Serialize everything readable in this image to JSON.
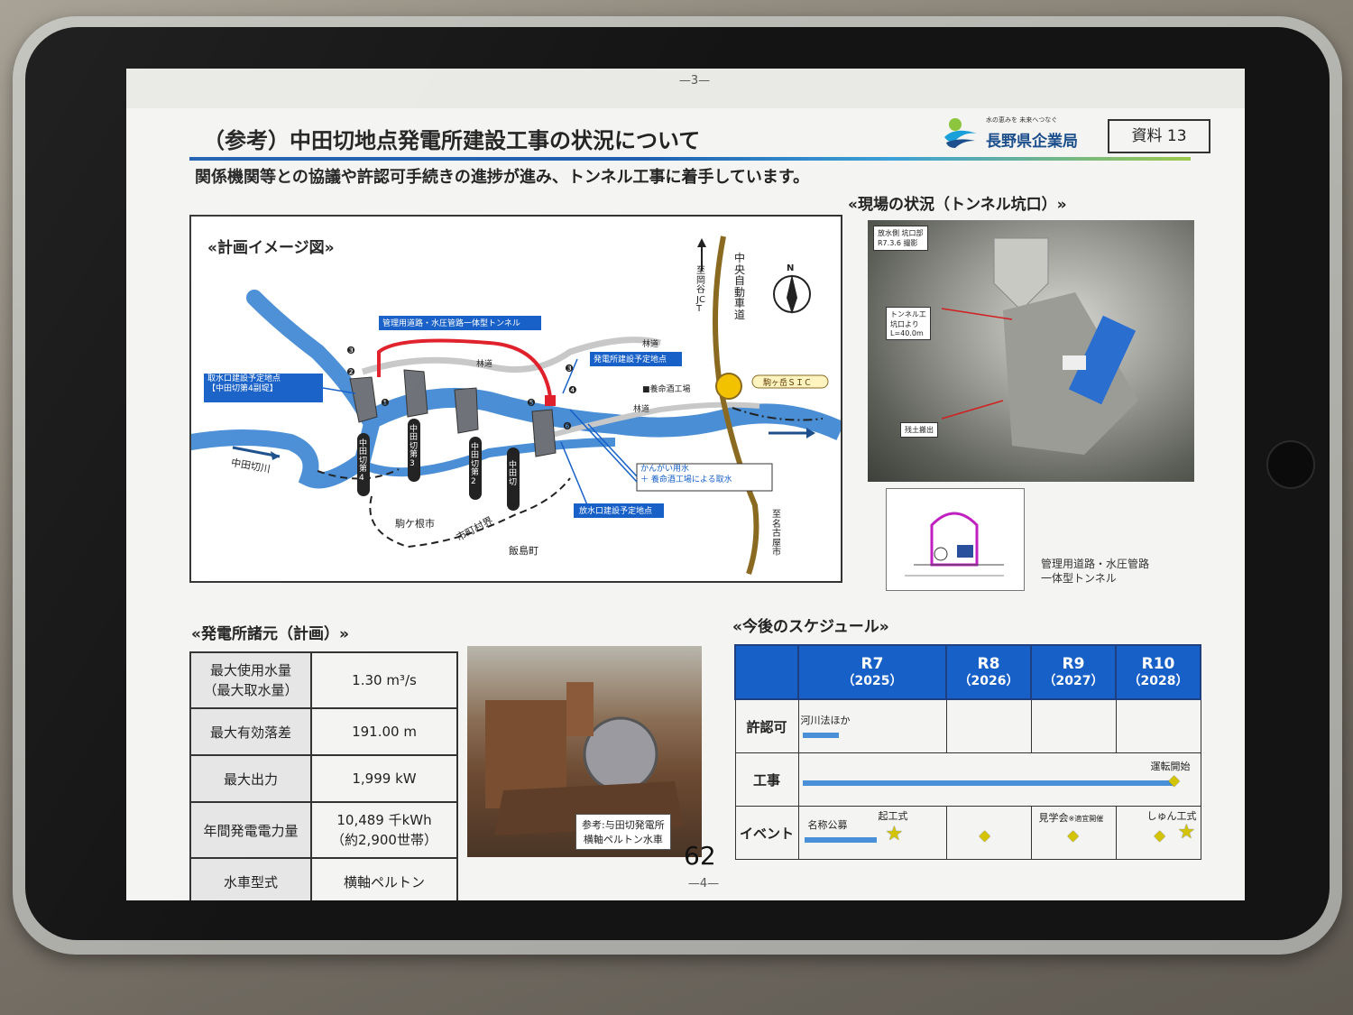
{
  "page": {
    "page_top": "—3—",
    "page_bottom": "—4—",
    "title": "（参考）中田切地点発電所建設工事の状況について",
    "subtitle": "関係機関等との協議や許認可手続きの進捗が進み、トンネル工事に着手しています。",
    "logo_tagline": "水の恵みを 未来へつなぐ",
    "logo_name": "長野県企業局",
    "doc_label": "資料 13",
    "handwritten": "62"
  },
  "plan": {
    "heading": "«計画イメージ図»",
    "labels": {
      "tunnel": "管理用道路・水圧管路一体型トンネル",
      "intake": "取水口建設予定地点\n【中田切第4副堤】",
      "powerhouse": "発電所建設予定地点",
      "outlet": "放水口建設予定地点",
      "irrigation": "かんがい用水\n＋ 養命酒工場による取水",
      "factory": "■養命酒工場",
      "road1": "林道",
      "road2": "林道",
      "road3": "林道",
      "expressway": "中央自動車道",
      "to_okaya": "至岡谷JCT",
      "to_nagoya": "至名古屋市",
      "ic": "駒ヶ岳ＳＩＣ",
      "river": "中田切川",
      "city1": "駒ケ根市",
      "city2": "飯島町",
      "boundary": "市町村界",
      "weir4": "中田切第4",
      "weir3": "中田切第3",
      "weir2": "中田切第2",
      "weir1": "中田切",
      "north": "N",
      "m1": "❶",
      "m2": "❷",
      "m3": "❸",
      "m5": "❺",
      "m6": "❻",
      "m3b": "❸",
      "m4": "❹"
    }
  },
  "site": {
    "heading": "«現場の状況（トンネル坑口）»",
    "photo_tag": "放水側 坑口部\nR7.3.6 撮影",
    "tunnel_tag": "トンネル工\n坑口より\nL=40.0m",
    "soil_tag": "残土搬出",
    "cross_caption": "管理用道路・水圧管路\n一体型トンネル"
  },
  "specs": {
    "heading": "«発電所諸元（計画）»",
    "rows": [
      {
        "k": "最大使用水量\n（最大取水量）",
        "v": "1.30 m³/s"
      },
      {
        "k": "最大有効落差",
        "v": "191.00 m"
      },
      {
        "k": "最大出力",
        "v": "1,999 kW"
      },
      {
        "k": "年間発電電力量",
        "v": "10,489 千kWh\n（約2,900世帯）"
      },
      {
        "k": "水車型式",
        "v": "横軸ペルトン"
      }
    ],
    "photo_caption": "参考:与田切発電所\n横軸ペルトン水車"
  },
  "schedule": {
    "heading": "«今後のスケジュール»",
    "years": [
      {
        "label": "R7",
        "sub": "（2025）"
      },
      {
        "label": "R8",
        "sub": "（2026）"
      },
      {
        "label": "R9",
        "sub": "（2027）"
      },
      {
        "label": "R10",
        "sub": "（2028）"
      }
    ],
    "rows": [
      "許認可",
      "工事",
      "イベント"
    ],
    "notes": {
      "permit": "河川法ほか",
      "start_operation": "運転開始",
      "naming": "名称公募",
      "groundbreaking": "起工式",
      "tour": "見学会",
      "tour_note": "※適宜開催",
      "completion": "しゅん工式"
    }
  }
}
